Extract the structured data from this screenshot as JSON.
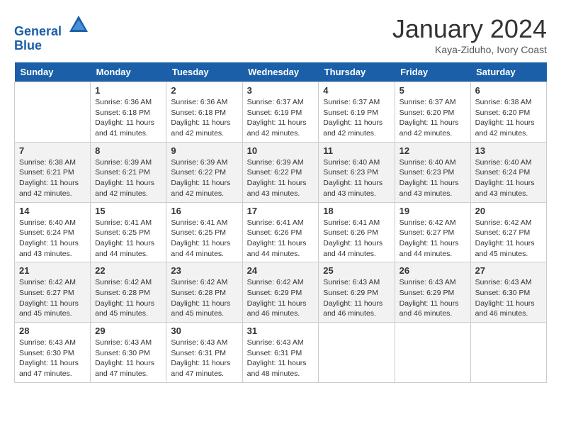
{
  "header": {
    "logo_line1": "General",
    "logo_line2": "Blue",
    "title": "January 2024",
    "subtitle": "Kaya-Ziduho, Ivory Coast"
  },
  "days_of_week": [
    "Sunday",
    "Monday",
    "Tuesday",
    "Wednesday",
    "Thursday",
    "Friday",
    "Saturday"
  ],
  "weeks": [
    [
      {
        "day": "",
        "info": ""
      },
      {
        "day": "1",
        "info": "Sunrise: 6:36 AM\nSunset: 6:18 PM\nDaylight: 11 hours\nand 41 minutes."
      },
      {
        "day": "2",
        "info": "Sunrise: 6:36 AM\nSunset: 6:18 PM\nDaylight: 11 hours\nand 42 minutes."
      },
      {
        "day": "3",
        "info": "Sunrise: 6:37 AM\nSunset: 6:19 PM\nDaylight: 11 hours\nand 42 minutes."
      },
      {
        "day": "4",
        "info": "Sunrise: 6:37 AM\nSunset: 6:19 PM\nDaylight: 11 hours\nand 42 minutes."
      },
      {
        "day": "5",
        "info": "Sunrise: 6:37 AM\nSunset: 6:20 PM\nDaylight: 11 hours\nand 42 minutes."
      },
      {
        "day": "6",
        "info": "Sunrise: 6:38 AM\nSunset: 6:20 PM\nDaylight: 11 hours\nand 42 minutes."
      }
    ],
    [
      {
        "day": "7",
        "info": "Sunrise: 6:38 AM\nSunset: 6:21 PM\nDaylight: 11 hours\nand 42 minutes."
      },
      {
        "day": "8",
        "info": "Sunrise: 6:39 AM\nSunset: 6:21 PM\nDaylight: 11 hours\nand 42 minutes."
      },
      {
        "day": "9",
        "info": "Sunrise: 6:39 AM\nSunset: 6:22 PM\nDaylight: 11 hours\nand 42 minutes."
      },
      {
        "day": "10",
        "info": "Sunrise: 6:39 AM\nSunset: 6:22 PM\nDaylight: 11 hours\nand 43 minutes."
      },
      {
        "day": "11",
        "info": "Sunrise: 6:40 AM\nSunset: 6:23 PM\nDaylight: 11 hours\nand 43 minutes."
      },
      {
        "day": "12",
        "info": "Sunrise: 6:40 AM\nSunset: 6:23 PM\nDaylight: 11 hours\nand 43 minutes."
      },
      {
        "day": "13",
        "info": "Sunrise: 6:40 AM\nSunset: 6:24 PM\nDaylight: 11 hours\nand 43 minutes."
      }
    ],
    [
      {
        "day": "14",
        "info": "Sunrise: 6:40 AM\nSunset: 6:24 PM\nDaylight: 11 hours\nand 43 minutes."
      },
      {
        "day": "15",
        "info": "Sunrise: 6:41 AM\nSunset: 6:25 PM\nDaylight: 11 hours\nand 44 minutes."
      },
      {
        "day": "16",
        "info": "Sunrise: 6:41 AM\nSunset: 6:25 PM\nDaylight: 11 hours\nand 44 minutes."
      },
      {
        "day": "17",
        "info": "Sunrise: 6:41 AM\nSunset: 6:26 PM\nDaylight: 11 hours\nand 44 minutes."
      },
      {
        "day": "18",
        "info": "Sunrise: 6:41 AM\nSunset: 6:26 PM\nDaylight: 11 hours\nand 44 minutes."
      },
      {
        "day": "19",
        "info": "Sunrise: 6:42 AM\nSunset: 6:27 PM\nDaylight: 11 hours\nand 44 minutes."
      },
      {
        "day": "20",
        "info": "Sunrise: 6:42 AM\nSunset: 6:27 PM\nDaylight: 11 hours\nand 45 minutes."
      }
    ],
    [
      {
        "day": "21",
        "info": "Sunrise: 6:42 AM\nSunset: 6:27 PM\nDaylight: 11 hours\nand 45 minutes."
      },
      {
        "day": "22",
        "info": "Sunrise: 6:42 AM\nSunset: 6:28 PM\nDaylight: 11 hours\nand 45 minutes."
      },
      {
        "day": "23",
        "info": "Sunrise: 6:42 AM\nSunset: 6:28 PM\nDaylight: 11 hours\nand 45 minutes."
      },
      {
        "day": "24",
        "info": "Sunrise: 6:42 AM\nSunset: 6:29 PM\nDaylight: 11 hours\nand 46 minutes."
      },
      {
        "day": "25",
        "info": "Sunrise: 6:43 AM\nSunset: 6:29 PM\nDaylight: 11 hours\nand 46 minutes."
      },
      {
        "day": "26",
        "info": "Sunrise: 6:43 AM\nSunset: 6:29 PM\nDaylight: 11 hours\nand 46 minutes."
      },
      {
        "day": "27",
        "info": "Sunrise: 6:43 AM\nSunset: 6:30 PM\nDaylight: 11 hours\nand 46 minutes."
      }
    ],
    [
      {
        "day": "28",
        "info": "Sunrise: 6:43 AM\nSunset: 6:30 PM\nDaylight: 11 hours\nand 47 minutes."
      },
      {
        "day": "29",
        "info": "Sunrise: 6:43 AM\nSunset: 6:30 PM\nDaylight: 11 hours\nand 47 minutes."
      },
      {
        "day": "30",
        "info": "Sunrise: 6:43 AM\nSunset: 6:31 PM\nDaylight: 11 hours\nand 47 minutes."
      },
      {
        "day": "31",
        "info": "Sunrise: 6:43 AM\nSunset: 6:31 PM\nDaylight: 11 hours\nand 48 minutes."
      },
      {
        "day": "",
        "info": ""
      },
      {
        "day": "",
        "info": ""
      },
      {
        "day": "",
        "info": ""
      }
    ]
  ]
}
